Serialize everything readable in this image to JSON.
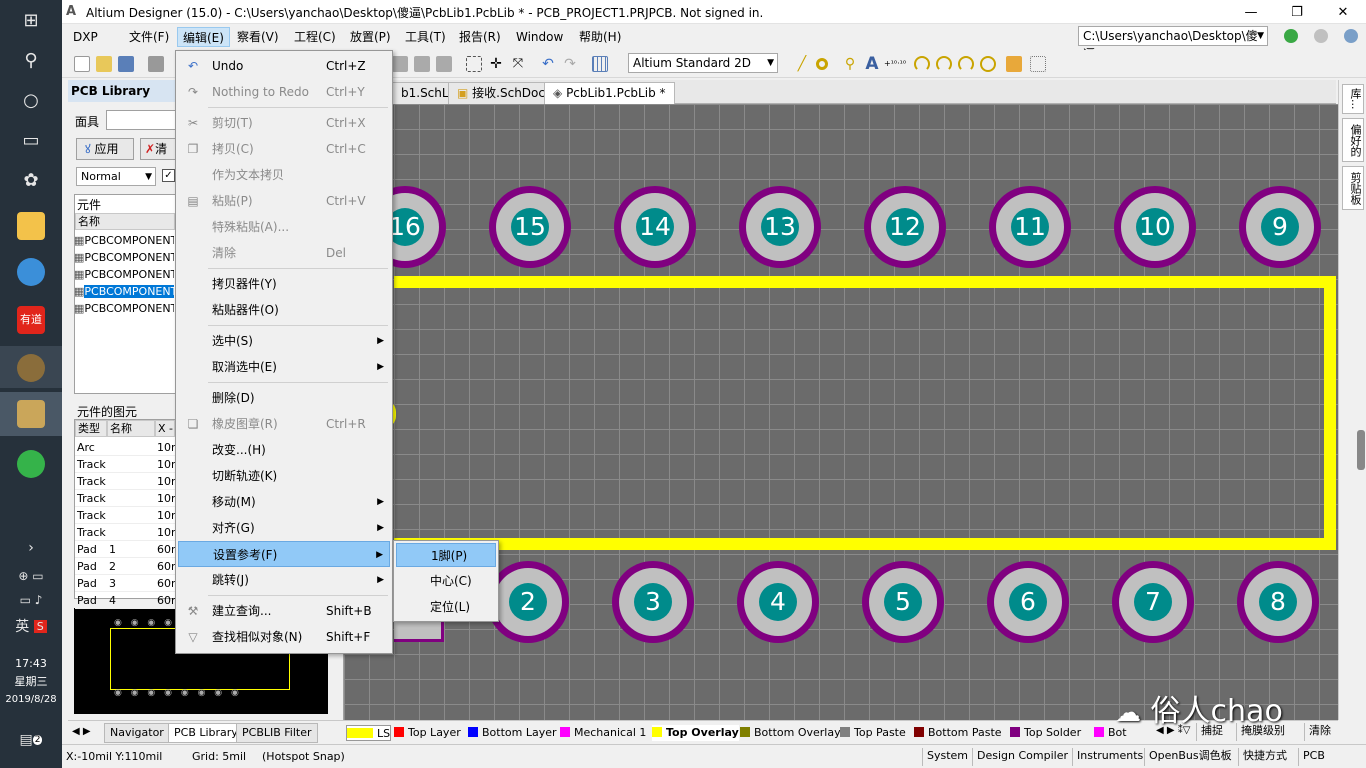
{
  "taskbar": {
    "clock_time": "17:43",
    "clock_day": "星期三",
    "clock_date": "2019/8/28",
    "ime": "英",
    "notif_count": "2",
    "apps": [
      {
        "name": "windows-start-icon",
        "color": "#ffffff"
      },
      {
        "name": "search-icon",
        "color": "#ffffff"
      },
      {
        "name": "cortana-icon",
        "color": "#ffffff"
      },
      {
        "name": "task-view-icon",
        "color": "#ffffff"
      },
      {
        "name": "pinwheel-app-icon",
        "color": "#ffffff"
      },
      {
        "name": "file-explorer-icon",
        "color": "#f3c24a"
      },
      {
        "name": "cloud-app-icon",
        "color": "#3b8fd9"
      },
      {
        "name": "youdao-dict-icon",
        "color": "#e1251b"
      },
      {
        "name": "avatar-app-icon",
        "color": "#8a6d3b"
      },
      {
        "name": "altium-app-icon",
        "color": "#caa65a"
      },
      {
        "name": "360-browser-icon",
        "color": "#35b34a"
      }
    ]
  },
  "titlebar": {
    "title": "Altium Designer (15.0) - C:\\Users\\yanchao\\Desktop\\傻逼\\PcbLib1.PcbLib * - PCB_PROJECT1.PRJPCB. Not signed in."
  },
  "menubar": {
    "items": [
      "DXP",
      "文件(F)",
      "编辑(E)",
      "察看(V)",
      "工程(C)",
      "放置(P)",
      "工具(T)",
      "报告(R)",
      "Window",
      "帮助(H)"
    ],
    "path_combo": "C:\\Users\\yanchao\\Desktop\\傻逼"
  },
  "toolbar": {
    "view_mode": "Altium Standard 2D"
  },
  "left_panel": {
    "title": "PCB Library",
    "mask_label": "面具",
    "apply_label": "应用",
    "clear_label": "清",
    "mode": "Normal",
    "components_section": "元件",
    "name_col": "名称",
    "components": [
      "PCBCOMPONENT",
      "PCBCOMPONENT",
      "PCBCOMPONENT",
      "PCBCOMPONENT",
      "PCBCOMPONENT"
    ],
    "selected_index": 3,
    "primitives_section": "元件的图元",
    "prim_cols": [
      "类型",
      "名称",
      "X -"
    ],
    "primitives": [
      {
        "type": "Arc",
        "name": "",
        "x": "10m"
      },
      {
        "type": "Track",
        "name": "",
        "x": "10m"
      },
      {
        "type": "Track",
        "name": "",
        "x": "10m"
      },
      {
        "type": "Track",
        "name": "",
        "x": "10m"
      },
      {
        "type": "Track",
        "name": "",
        "x": "10m"
      },
      {
        "type": "Track",
        "name": "",
        "x": "10m"
      },
      {
        "type": "Pad",
        "name": "1",
        "x": "60m"
      },
      {
        "type": "Pad",
        "name": "2",
        "x": "60m"
      },
      {
        "type": "Pad",
        "name": "3",
        "x": "60m"
      },
      {
        "type": "Pad",
        "name": "4",
        "x": "60m"
      }
    ]
  },
  "doc_tabs": [
    "b1.SchLib",
    "接收.SchDoc",
    "PcbLib1.PcbLib *"
  ],
  "canvas": {
    "top_pads": [
      "16",
      "15",
      "14",
      "13",
      "12",
      "11",
      "10",
      "9"
    ],
    "bottom_pads": [
      "2",
      "3",
      "4",
      "5",
      "6",
      "7",
      "8"
    ],
    "overlay_color": "#ffff00",
    "pad_ring_color": "#800080",
    "hole_color": "#008b8b"
  },
  "right_strip": [
    "库...",
    "偏好的",
    "剪贴板"
  ],
  "edit_menu": [
    {
      "label": "Undo",
      "shortcut": "Ctrl+Z",
      "icon": "undo-icon",
      "disabled": false
    },
    {
      "label": "Nothing to Redo",
      "shortcut": "Ctrl+Y",
      "icon": "redo-icon",
      "disabled": true
    },
    {
      "label": "剪切(T)",
      "shortcut": "Ctrl+X",
      "icon": "cut-icon",
      "disabled": true
    },
    {
      "label": "拷贝(C)",
      "shortcut": "Ctrl+C",
      "icon": "copy-icon",
      "disabled": true
    },
    {
      "label": "作为文本拷贝",
      "shortcut": "",
      "icon": "",
      "disabled": true
    },
    {
      "label": "粘贴(P)",
      "shortcut": "Ctrl+V",
      "icon": "paste-icon",
      "disabled": true
    },
    {
      "label": "特殊粘贴(A)...",
      "shortcut": "",
      "icon": "",
      "disabled": true
    },
    {
      "label": "清除",
      "shortcut": "Del",
      "icon": "",
      "disabled": true
    },
    {
      "label": "拷贝器件(Y)",
      "shortcut": "",
      "icon": "",
      "disabled": false
    },
    {
      "label": "粘贴器件(O)",
      "shortcut": "",
      "icon": "",
      "disabled": false
    },
    {
      "label": "选中(S)",
      "shortcut": "",
      "icon": "",
      "disabled": false,
      "submenu": true
    },
    {
      "label": "取消选中(E)",
      "shortcut": "",
      "icon": "",
      "disabled": false,
      "submenu": true
    },
    {
      "label": "删除(D)",
      "shortcut": "",
      "icon": "",
      "disabled": false
    },
    {
      "label": "橡皮图章(R)",
      "shortcut": "Ctrl+R",
      "icon": "stamp-icon",
      "disabled": true
    },
    {
      "label": "改变...(H)",
      "shortcut": "",
      "icon": "",
      "disabled": false
    },
    {
      "label": "切断轨迹(K)",
      "shortcut": "",
      "icon": "",
      "disabled": false
    },
    {
      "label": "移动(M)",
      "shortcut": "",
      "icon": "",
      "disabled": false,
      "submenu": true
    },
    {
      "label": "对齐(G)",
      "shortcut": "",
      "icon": "",
      "disabled": false,
      "submenu": true
    },
    {
      "label": "设置参考(F)",
      "shortcut": "",
      "icon": "",
      "disabled": false,
      "submenu": true,
      "highlight": true
    },
    {
      "label": "跳转(J)",
      "shortcut": "",
      "icon": "",
      "disabled": false,
      "submenu": true
    },
    {
      "label": "建立查询...",
      "shortcut": "Shift+B",
      "icon": "query-icon",
      "disabled": false
    },
    {
      "label": "查找相似对象(N)",
      "shortcut": "Shift+F",
      "icon": "filter-icon",
      "disabled": false
    }
  ],
  "ref_submenu": [
    "1脚(P)",
    "中心(C)",
    "定位(L)"
  ],
  "left_tabs": [
    "Navigator",
    "PCB Library",
    "PCBLIB Filter"
  ],
  "layers": [
    {
      "name": "LS",
      "color": "#ffff00"
    },
    {
      "name": "Top Layer",
      "color": "#ff0000"
    },
    {
      "name": "Bottom Layer",
      "color": "#0000ff"
    },
    {
      "name": "Mechanical 1",
      "color": "#ff00ff"
    },
    {
      "name": "Top Overlay",
      "color": "#ffff00"
    },
    {
      "name": "Bottom Overlay",
      "color": "#808000"
    },
    {
      "name": "Top Paste",
      "color": "#808080"
    },
    {
      "name": "Bottom Paste",
      "color": "#800000"
    },
    {
      "name": "Top Solder",
      "color": "#800080"
    },
    {
      "name": "Bot",
      "color": "#ff00ff"
    }
  ],
  "layer_buttons": [
    "捕捉",
    "掩膜级别",
    "清除"
  ],
  "status": {
    "coords": "X:-10mil Y:110mil",
    "grid": "Grid: 5mil",
    "snap": "(Hotspot Snap)",
    "buttons": [
      "System",
      "Design Compiler",
      "Instruments",
      "OpenBus调色板",
      "快捷方式",
      "PCB"
    ]
  },
  "watermark": "俗人chao"
}
